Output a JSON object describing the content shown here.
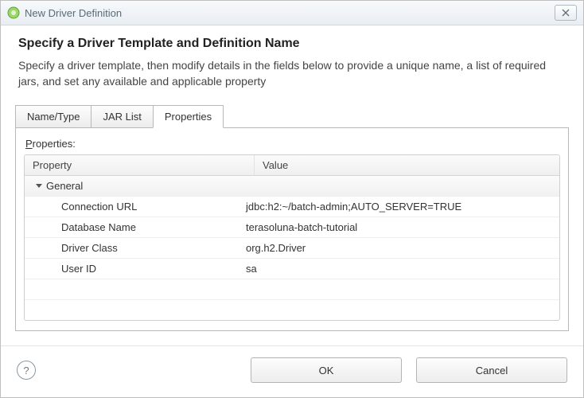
{
  "window": {
    "title": "New Driver Definition"
  },
  "header": {
    "heading": "Specify a Driver Template and Definition Name",
    "description": "Specify a driver template, then modify details in the fields below to provide a unique name, a list of required jars, and set any available and applicable property"
  },
  "tabs": {
    "name_type": "Name/Type",
    "jar_list": "JAR List",
    "properties": "Properties"
  },
  "panel": {
    "label_prefix": "P",
    "label_rest": "roperties:"
  },
  "table": {
    "header_property": "Property",
    "header_value": "Value",
    "group_general": "General",
    "rows": {
      "connection_url": {
        "label": "Connection URL",
        "value": "jdbc:h2:~/batch-admin;AUTO_SERVER=TRUE"
      },
      "database_name": {
        "label": "Database Name",
        "value": "terasoluna-batch-tutorial"
      },
      "driver_class": {
        "label": "Driver Class",
        "value": "org.h2.Driver"
      },
      "user_id": {
        "label": "User ID",
        "value": "sa"
      }
    }
  },
  "footer": {
    "help_tooltip": "Help",
    "ok": "OK",
    "cancel": "Cancel"
  }
}
